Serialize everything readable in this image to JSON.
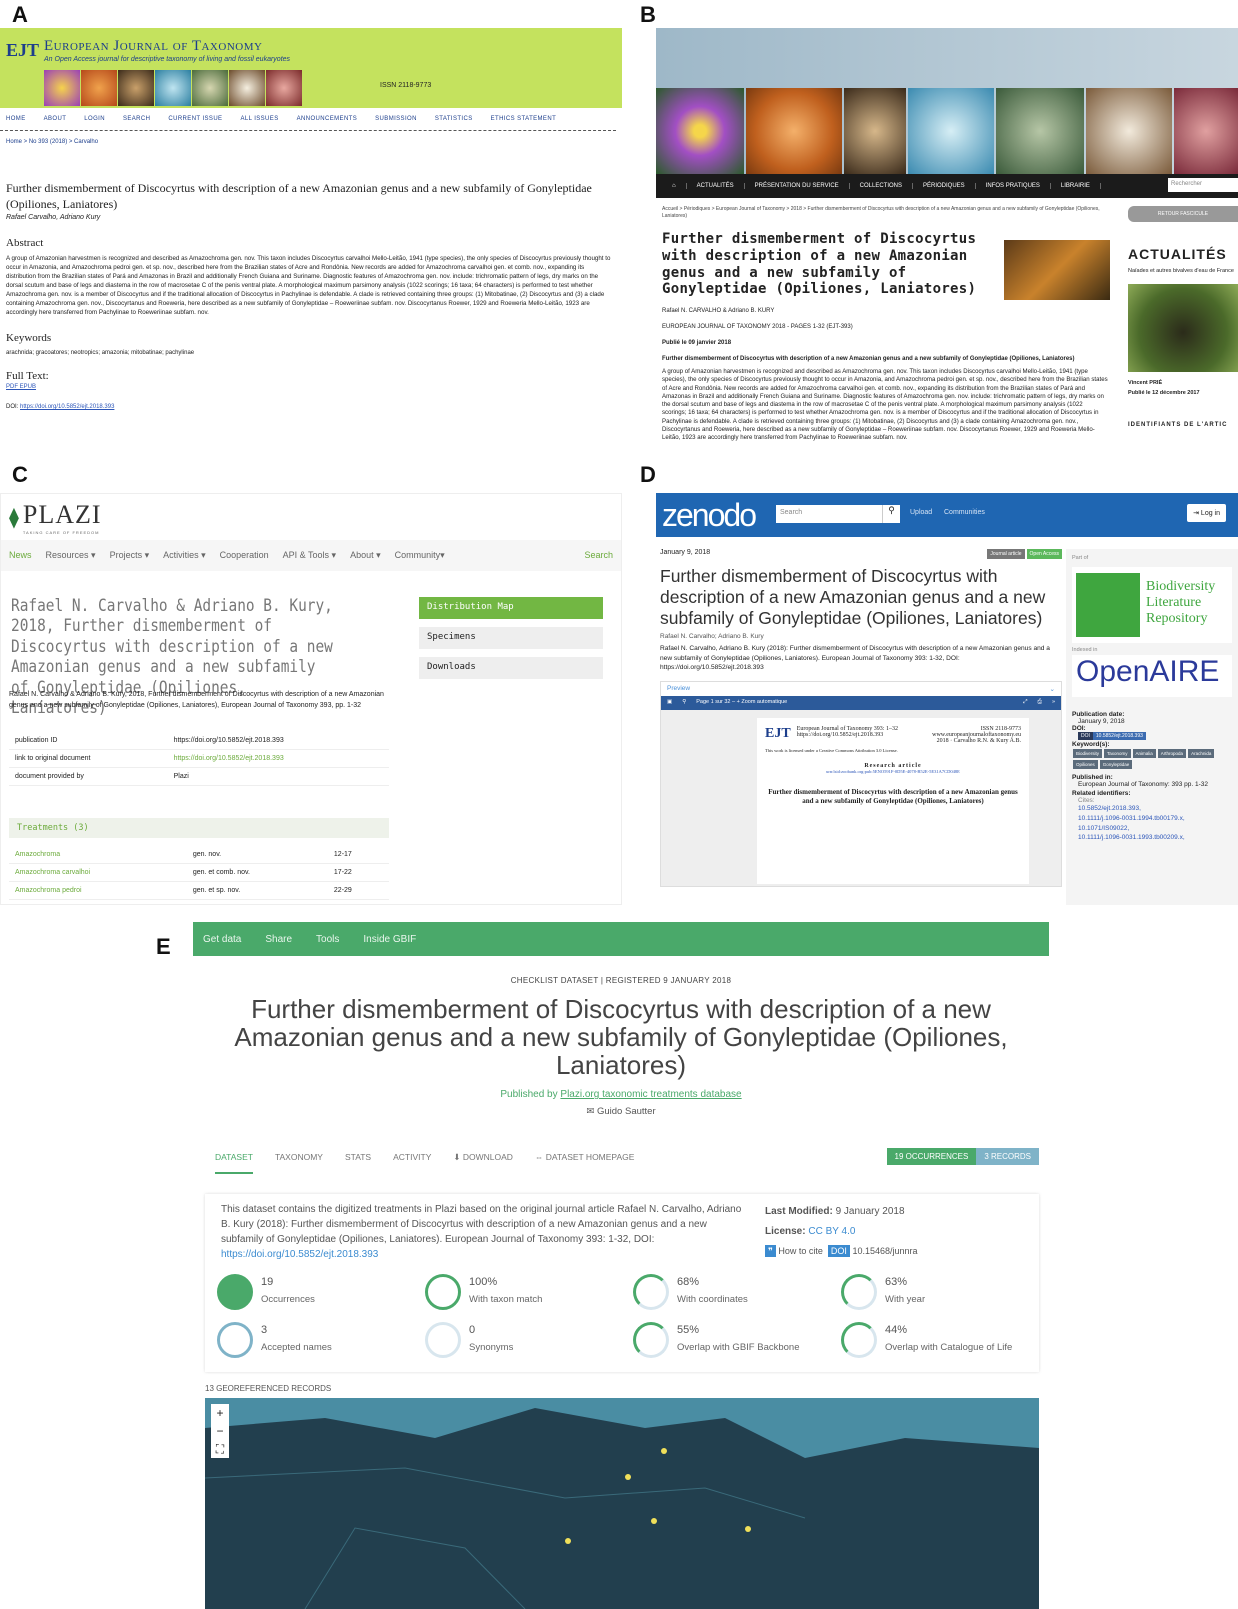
{
  "labels": {
    "a": "A",
    "b": "B",
    "c": "C",
    "d": "D",
    "e": "E"
  },
  "panelA": {
    "logo": "EJT",
    "journal": "European Journal of Taxonomy",
    "subtitle": "An Open Access journal for descriptive taxonomy of living and fossil eukaryotes",
    "issn": "ISSN 2118-9773",
    "nav": [
      "HOME",
      "ABOUT",
      "LOGIN",
      "SEARCH",
      "CURRENT ISSUE",
      "ALL ISSUES",
      "ANNOUNCEMENTS",
      "SUBMISSION",
      "STATISTICS",
      "ETHICS STATEMENT"
    ],
    "breadcrumb": "Home > No 393 (2018) > Carvalho",
    "title": "Further dismemberment of Discocyrtus with description of a new Amazonian genus and a new subfamily of Gonyleptidae (Opiliones, Laniatores)",
    "authors": "Rafael Carvalho, Adriano Kury",
    "abstract_h": "Abstract",
    "abstract": "A group of Amazonian harvestmen is recognized and described as Amazochroma gen. nov. This taxon includes Discocyrtus carvalhoi Mello-Leitão, 1941 (type species), the only species of Discocyrtus previously thought to occur in Amazonia, and Amazochroma pedroi gen. et sp. nov., described here from the Brazilian states of Acre and Rondônia. New records are added for Amazochroma carvalhoi gen. et comb. nov., expanding its distribution from the Brazilian states of Pará and Amazonas in Brazil and additionally French Guiana and Suriname. Diagnostic features of Amazochroma gen. nov. include: trichromatic pattern of legs, dry marks on the dorsal scutum and base of legs and diastema in the row of macrosetae C of the penis ventral plate. A morphological maximum parsimony analysis (1022 scorings; 16 taxa; 64 characters) is performed to test whether Amazochroma gen. nov. is a member of Discocyrtus and if the traditional allocation of Discocyrtus in Pachylinae is defendable. A clade is retrieved containing three groups: (1) Mitobatinae, (2) Discocyrtus and (3) a clade containing Amazochroma gen. nov., Discocyrtanus and Roeweria, here described as a new subfamily of Gonyleptidae – Roeweriinae subfam. nov. Discocyrtanus Roewer, 1929 and Roeweria Mello-Leitão, 1923 are accordingly here transferred from Pachylinae to Roeweriinae subfam. nov.",
    "keywords_h": "Keywords",
    "keywords": "arachnida; gracoatores; neotropics; amazonia; mitobatinae; pachylinae",
    "fulltext_h": "Full Text:",
    "fulltext": "PDF EPUB",
    "doi_label": "DOI:",
    "doi": "https://doi.org/10.5852/ejt.2018.393"
  },
  "panelB": {
    "nav": [
      "ACTUALITÉS",
      "PRÉSENTATION DU SERVICE",
      "COLLECTIONS",
      "PÉRIODIQUES",
      "INFOS PRATIQUES",
      "LIBRAIRIE"
    ],
    "search": "Rechercher",
    "breadcrumb": "Accueil > Périodiques > European Journal of Taxonomy > 2018 > Further dismemberment of Discocyrtus with description of a new Amazonian genus and a new subfamily of Gonyleptidae (Opiliones, Laniatores)",
    "title": "Further dismemberment of Discocyrtus with description of a new Amazonian genus and a new subfamily of Gonyleptidae (Opiliones, Laniatores)",
    "authors": "Rafael N. CARVALHO & Adriano B. KURY",
    "journal": "EUROPEAN JOURNAL OF TAXONOMY 2018 - PAGES 1-32 (EJT-393)",
    "published": "Publié le 09 janvier 2018",
    "subtitle": "Further dismemberment of Discocyrtus with description of a new Amazonian genus and a new subfamily of Gonyleptidae (Opiliones, Laniatores)",
    "abstract": "A group of Amazonian harvestmen is recognized and described as Amazochroma gen. nov. This taxon includes Discocyrtus carvalhoi Mello-Leitão, 1941 (type species), the only species of Discocyrtus previously thought to occur in Amazonia, and Amazochroma pedroi gen. et sp. nov., described here from the Brazilian states of Acre and Rondônia. New records are added for Amazochroma carvalhoi gen. et comb. nov., expanding its distribution from the Brazilian states of Pará and Amazonas in Brazil and additionally French Guiana and Suriname. Diagnostic features of Amazochroma gen. nov. include: trichromatic pattern of legs, dry marks on the dorsal scutum and base of legs and diastema in the row of macrosetae C of the penis ventral plate. A morphological maximum parsimony analysis (1022 scorings; 16 taxa; 64 characters) is performed to test whether Amazochroma gen. nov. is a member of Discocyrtus and if the traditional allocation of Discocyrtus in Pachylinae is defendable. A clade is retrieved containing three groups: (1) Mitobatinae, (2) Discocyrtus and (3) a clade containing Amazochroma gen. nov., Discocyrtanus and Roeweria, here described as a new subfamily of Gonyleptidae – Roeweriinae subfam. nov. Discocyrtanus Roewer, 1929 and Roeweria Mello-Leitão, 1923 are accordingly here transferred from Pachylinae to Roeweriinae subfam. nov.",
    "return": "RETOUR FASCICULE",
    "actualites": "ACTUALITÉS",
    "news_sub": "Naïades et autres bivalves d'eau de France",
    "prize": "Vincent PRIÉ",
    "prize_date": "Publié le 12 décembre 2017",
    "identifiers": "IDENTIFIANTS DE L'ARTIC"
  },
  "panelC": {
    "logo": "PLAZI",
    "tagline": "TAKING CARE OF FREEDOM",
    "nav": [
      "News",
      "Resources ▾",
      "Projects ▾",
      "Activities ▾",
      "Cooperation",
      "API & Tools ▾",
      "About ▾",
      "Community▾"
    ],
    "search": "Search",
    "title": "Rafael N. Carvalho & Adriano B. Kury, 2018, Further dismemberment of Discocyrtus with description of a new Amazonian genus and a new subfamily of Gonyleptidae (Opiliones, Laniatores)",
    "buttons": [
      "Distribution Map",
      "Specimens",
      "Downloads"
    ],
    "citation": "Rafael N. Carvalho & Adriano B. Kury, 2018, Further dismemberment of Discocyrtus with description of a new Amazonian genus and a new subfamily of Gonyleptidae (Opiliones, Laniatores), European Journal of Taxonomy 393, pp. 1-32",
    "meta": [
      {
        "k": "publication ID",
        "v": "https://doi.org/10.5852/ejt.2018.393"
      },
      {
        "k": "link to original document",
        "v": "https://doi.org/10.5852/ejt.2018.393"
      },
      {
        "k": "document provided by",
        "v": "Plazi"
      }
    ],
    "treatments_h": "Treatments (3)",
    "treatments": [
      {
        "n": "Amazochroma",
        "s": "gen. nov.",
        "p": "12-17"
      },
      {
        "n": "Amazochroma carvalhoi",
        "s": "gen. et comb. nov.",
        "p": "17-22"
      },
      {
        "n": "Amazochroma pedroi",
        "s": "gen. et sp. nov.",
        "p": "22-29"
      }
    ]
  },
  "panelD": {
    "logo": "zenodo",
    "search": "Search",
    "upload": "Upload",
    "communities": "Communities",
    "login": "Log in",
    "date": "January 9, 2018",
    "badge1": "Journal article",
    "badge2": "Open Access",
    "title": "Further dismemberment of Discocyrtus with description of a new Amazonian genus and a new subfamily of Gonyleptidae (Opiliones, Laniatores)",
    "authors": "Rafael N. Carvalho; Adriano B. Kury",
    "citation": "Rafael N. Carvalho, Adriano B. Kury (2018): Further dismemberment of Discocyrtus with description of a new Amazonian genus and a new subfamily of Gonyleptidae (Opiliones, Laniatores). European Journal of Taxonomy 393: 1-32, DOI: https://doi.org/10.5852/ejt.2018.393",
    "preview": "Preview",
    "pdfbar": "Page  1  sur 32  –  +  Zoom automatique",
    "paper_journal": "European Journal of Taxonomy 393: 1–32",
    "paper_doi": "https://doi.org/10.5852/ejt.2018.393",
    "paper_issn": "ISSN 2118-9773",
    "paper_url": "www.europeanjournaloftaxonomy.eu",
    "paper_year": "2018 · Carvalho R.N. & Kury A.B.",
    "paper_lic": "This work is licensed under a Creative Commons Attribution 3.0 License.",
    "paper_type": "Research article",
    "paper_lsid": "urn:lsid:zoobank.org:pub:5ENO591F-0D5E-4078-B52E-5E31A7CD048E",
    "paper_title": "Further dismemberment of Discocyrtus with description of a new Amazonian genus and a new subfamily of Gonyleptidae (Opiliones, Laniatores)",
    "partof": "Part of",
    "blr": "Biodiversity Literature Repository",
    "indexed": "Indexed in",
    "openaire": "OpenAIRE",
    "pubdate_h": "Publication date:",
    "pubdate": "January 9, 2018",
    "doi_h": "DOI:",
    "doi": "10.5852/ejt.2018.393",
    "kw_h": "Keyword(s):",
    "keywords": [
      "Biodiversity",
      "Taxonomy",
      "Animalia",
      "Arthropoda",
      "Arachnida",
      "Opiliones",
      "Gonyleptidae"
    ],
    "pubin_h": "Published in:",
    "pubin": "European Journal of Taxonomy: 393 pp. 1-32",
    "related_h": "Related identifiers:",
    "cites": "Cites:",
    "related": [
      "10.5852/ejt.2018.393,",
      "10.1111/j.1096-0031.1994.tb00179.x,",
      "10.1071/IS09022,",
      "10.1111/j.1096-0031.1993.tb00209.x,"
    ]
  },
  "panelE": {
    "nav": [
      "Get data",
      "Share",
      "Tools",
      "Inside GBIF"
    ],
    "eyebrow": "CHECKLIST DATASET  |  REGISTERED 9 JANUARY 2018",
    "title": "Further dismemberment of Discocyrtus with description of a new Amazonian genus and a new subfamily of Gonyleptidae (Opiliones, Laniatores)",
    "pub_pre": "Published by",
    "publisher": "Plazi.org taxonomic treatments database",
    "contact": "✉ Guido Sautter",
    "tabs": [
      "DATASET",
      "TAXONOMY",
      "STATS",
      "ACTIVITY",
      "⬇ DOWNLOAD",
      "⇔ DATASET HOMEPAGE"
    ],
    "occ": "19 OCCURRENCES",
    "rec": "3 RECORDS",
    "desc": "This dataset contains the digitized treatments in Plazi based on the original journal article Rafael N. Carvalho, Adriano B. Kury (2018): Further dismemberment of Discocyrtus with description of a new Amazonian genus and a new subfamily of Gonyleptidae (Opiliones, Laniatores). European Journal of Taxonomy 393: 1-32, DOI:",
    "desc_link": "https://doi.org/10.5852/ejt.2018.393",
    "modified_h": "Last Modified:",
    "modified": "9 January 2018",
    "license_h": "License:",
    "license": "CC BY 4.0",
    "cite": "How to cite",
    "doi_tag": "DOI",
    "doi": "10.15468/junnra",
    "stats": [
      {
        "v": "19",
        "l": "Occurrences",
        "pct": 100
      },
      {
        "v": "100%",
        "l": "With taxon match",
        "pct": 100
      },
      {
        "v": "68%",
        "l": "With coordinates",
        "pct": 68
      },
      {
        "v": "63%",
        "l": "With year",
        "pct": 63
      },
      {
        "v": "3",
        "l": "Accepted names",
        "pct": 100
      },
      {
        "v": "0",
        "l": "Synonyms",
        "pct": 0
      },
      {
        "v": "55%",
        "l": "Overlap with GBIF Backbone",
        "pct": 55
      },
      {
        "v": "44%",
        "l": "Overlap with Catalogue of Life",
        "pct": 44
      }
    ],
    "geo": "13 GEOREFERENCED RECORDS"
  }
}
